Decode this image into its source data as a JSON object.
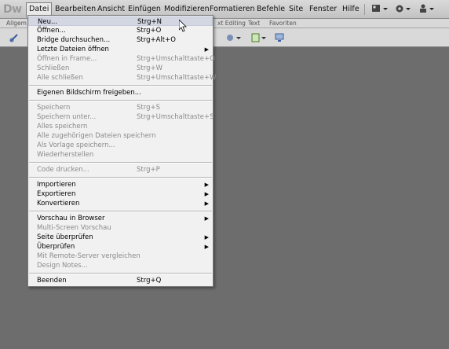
{
  "app": {
    "logo": "Dw"
  },
  "menubar": {
    "items": [
      "Datei",
      "Bearbeiten",
      "Ansicht",
      "Einfügen",
      "Modifizieren",
      "Formatieren",
      "Befehle",
      "Site",
      "Fenster",
      "Hilfe"
    ],
    "active": "Datei",
    "right_icons": [
      "layout-icon",
      "gear-icon",
      "user-icon"
    ]
  },
  "tabstrip": {
    "tabs": [
      "Allgem",
      "xt Editing",
      "Text",
      "Favoriten"
    ]
  },
  "dropdown": {
    "items": [
      {
        "label": "Neu...",
        "shortcut": "Strg+N",
        "disabled": false,
        "hover": true
      },
      {
        "label": "Öffnen...",
        "shortcut": "Strg+O",
        "disabled": false
      },
      {
        "label": "Bridge durchsuchen...",
        "shortcut": "Strg+Alt+O",
        "disabled": false
      },
      {
        "label": "Letzte Dateien öffnen",
        "shortcut": "",
        "disabled": false,
        "submenu": true
      },
      {
        "label": "Öffnen in Frame...",
        "shortcut": "Strg+Umschalttaste+O",
        "disabled": true
      },
      {
        "label": "Schließen",
        "shortcut": "Strg+W",
        "disabled": true
      },
      {
        "label": "Alle schließen",
        "shortcut": "Strg+Umschalttaste+W",
        "disabled": true
      },
      {
        "sep": true
      },
      {
        "label": "Eigenen Bildschirm freigeben...",
        "shortcut": "",
        "disabled": false
      },
      {
        "sep": true
      },
      {
        "label": "Speichern",
        "shortcut": "Strg+S",
        "disabled": true
      },
      {
        "label": "Speichern unter...",
        "shortcut": "Strg+Umschalttaste+S",
        "disabled": true
      },
      {
        "label": "Alles speichern",
        "shortcut": "",
        "disabled": true
      },
      {
        "label": "Alle zugehörigen Dateien speichern",
        "shortcut": "",
        "disabled": true
      },
      {
        "label": "Als Vorlage speichern...",
        "shortcut": "",
        "disabled": true
      },
      {
        "label": "Wiederherstellen",
        "shortcut": "",
        "disabled": true
      },
      {
        "sep": true
      },
      {
        "label": "Code drucken...",
        "shortcut": "Strg+P",
        "disabled": true
      },
      {
        "sep": true
      },
      {
        "label": "Importieren",
        "shortcut": "",
        "disabled": false,
        "submenu": true
      },
      {
        "label": "Exportieren",
        "shortcut": "",
        "disabled": false,
        "submenu": true
      },
      {
        "label": "Konvertieren",
        "shortcut": "",
        "disabled": false,
        "submenu": true
      },
      {
        "sep": true
      },
      {
        "label": "Vorschau in Browser",
        "shortcut": "",
        "disabled": false,
        "submenu": true
      },
      {
        "label": "Multi-Screen Vorschau",
        "shortcut": "",
        "disabled": true
      },
      {
        "label": "Seite überprüfen",
        "shortcut": "",
        "disabled": false,
        "submenu": true
      },
      {
        "label": "Überprüfen",
        "shortcut": "",
        "disabled": false,
        "submenu": true
      },
      {
        "label": "Mit Remote-Server vergleichen",
        "shortcut": "",
        "disabled": true
      },
      {
        "label": "Design Notes...",
        "shortcut": "",
        "disabled": true
      },
      {
        "sep": true
      },
      {
        "label": "Beenden",
        "shortcut": "Strg+Q",
        "disabled": false
      }
    ]
  }
}
